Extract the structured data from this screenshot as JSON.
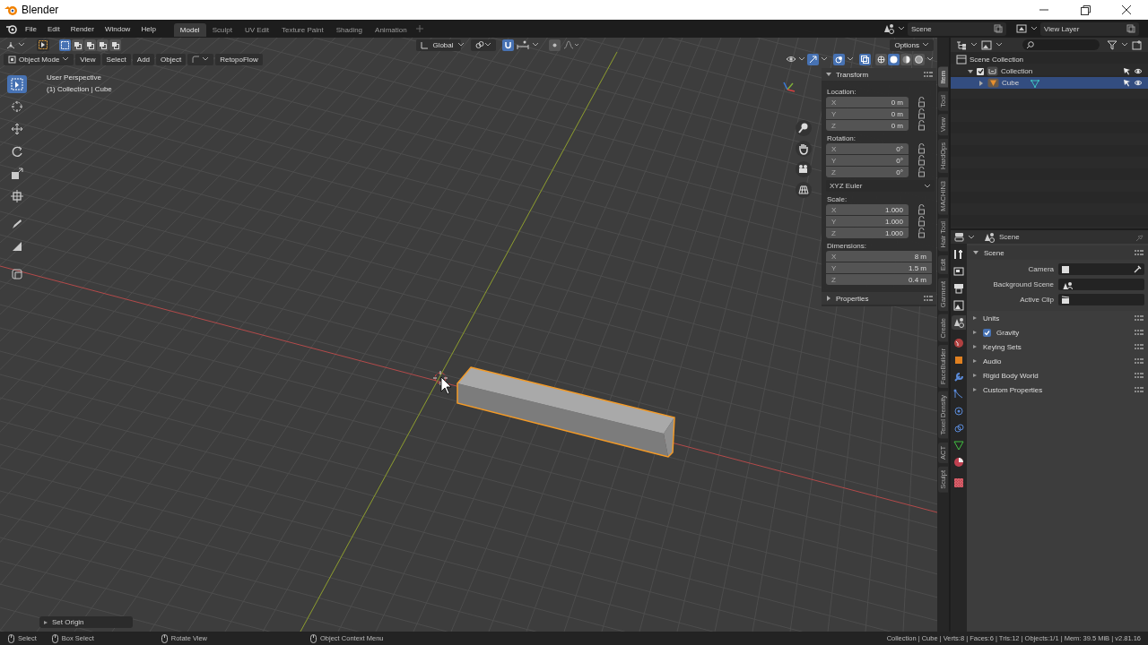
{
  "window": {
    "title": "Blender"
  },
  "menu": [
    "File",
    "Edit",
    "Render",
    "Window",
    "Help"
  ],
  "workspaces": [
    {
      "label": "Model",
      "selected": true
    },
    {
      "label": "Sculpt",
      "selected": false
    },
    {
      "label": "UV Edit",
      "selected": false
    },
    {
      "label": "Texture Paint",
      "selected": false
    },
    {
      "label": "Shading",
      "selected": false
    },
    {
      "label": "Animation",
      "selected": false
    }
  ],
  "scene": {
    "value": "Scene"
  },
  "view_layer": {
    "value": "View Layer"
  },
  "viewport": {
    "select_modes": [
      {
        "selected": true
      },
      {
        "selected": false
      },
      {
        "selected": false
      },
      {
        "selected": false
      },
      {
        "selected": false
      }
    ],
    "orientation": "Global",
    "snap": {
      "on": true
    },
    "options": "Options",
    "mode": "Object Mode",
    "menus": [
      "View",
      "Select",
      "Add",
      "Object"
    ],
    "addon_menu": "RetopoFlow",
    "gizmos": {
      "on": true
    },
    "overlays": {
      "on": true
    },
    "xray": {
      "on": true
    },
    "shading_modes": [
      {
        "selected": false
      },
      {
        "selected": true
      },
      {
        "selected": false
      },
      {
        "selected": false
      }
    ],
    "view_name": "User Perspective",
    "object_info": "(1) Collection | Cube",
    "tools": [
      {
        "selected": true
      },
      {
        "selected": false
      },
      {
        "selected": false
      },
      {
        "selected": false
      },
      {
        "selected": false
      },
      {
        "selected": false
      },
      {
        "selected": false
      },
      {
        "selected": false
      },
      {
        "selected": false
      }
    ],
    "last_operator": "Set Origin"
  },
  "sidebar": {
    "tabs": [
      {
        "label": "Item",
        "selected": true
      },
      {
        "label": "Tool",
        "selected": false
      },
      {
        "label": "View",
        "selected": false
      },
      {
        "label": "HardOps",
        "selected": false
      },
      {
        "label": "MACHIN3",
        "selected": false
      },
      {
        "label": "Hair Tool",
        "selected": false
      },
      {
        "label": "Edit",
        "selected": false
      },
      {
        "label": "Garment",
        "selected": false
      },
      {
        "label": "Create",
        "selected": false
      },
      {
        "label": "FaceBuilder",
        "selected": false
      },
      {
        "label": "Texel Density",
        "selected": false
      },
      {
        "label": "ACT",
        "selected": false
      },
      {
        "label": "Sculpt",
        "selected": false
      }
    ],
    "transform": {
      "title": "Transform",
      "expanded": true
    },
    "location": {
      "label": "Location:",
      "fields": [
        {
          "axis": "X",
          "value": "0 m"
        },
        {
          "axis": "Y",
          "value": "0 m"
        },
        {
          "axis": "Z",
          "value": "0 m"
        }
      ]
    },
    "rotation": {
      "label": "Rotation:",
      "fields": [
        {
          "axis": "X",
          "value": "0°"
        },
        {
          "axis": "Y",
          "value": "0°"
        },
        {
          "axis": "Z",
          "value": "0°"
        }
      ]
    },
    "rotation_mode": "XYZ Euler",
    "scale": {
      "label": "Scale:",
      "fields": [
        {
          "axis": "X",
          "value": "1.000"
        },
        {
          "axis": "Y",
          "value": "1.000"
        },
        {
          "axis": "Z",
          "value": "1.000"
        }
      ]
    },
    "dimensions": {
      "label": "Dimensions:",
      "fields": [
        {
          "axis": "X",
          "value": "8 m"
        },
        {
          "axis": "Y",
          "value": "1.5 m"
        },
        {
          "axis": "Z",
          "value": "0.4 m"
        }
      ]
    },
    "properties": {
      "title": "Properties",
      "expanded": false
    }
  },
  "outliner": {
    "items": [
      {
        "label": "Scene Collection",
        "selected": false,
        "children": [
          {
            "label": "Collection",
            "selected": false,
            "checked": true,
            "expanded": true,
            "children": [
              {
                "label": "Cube",
                "selected": true,
                "expanded": false
              }
            ]
          }
        ]
      }
    ]
  },
  "properties": {
    "tabs": [
      {
        "selected": false
      },
      {
        "selected": false
      },
      {
        "selected": false
      },
      {
        "selected": false
      },
      {
        "selected": true
      },
      {
        "selected": false
      },
      {
        "selected": false
      },
      {
        "selected": false
      },
      {
        "selected": false
      },
      {
        "selected": false
      },
      {
        "selected": false
      },
      {
        "selected": false
      },
      {
        "selected": false
      },
      {
        "selected": false
      }
    ],
    "context": "Scene",
    "panel": {
      "title": "Scene",
      "expanded": true,
      "fields": [
        {
          "label": "Camera"
        },
        {
          "label": "Background Scene"
        },
        {
          "label": "Active Clip"
        }
      ]
    },
    "subpanels": [
      {
        "label": "Units",
        "kind": "panel"
      },
      {
        "label": "Gravity",
        "kind": "checkbox",
        "checked": true
      },
      {
        "label": "Keying Sets",
        "kind": "panel"
      },
      {
        "label": "Audio",
        "kind": "panel"
      },
      {
        "label": "Rigid Body World",
        "kind": "panel"
      },
      {
        "label": "Custom Properties",
        "kind": "panel"
      }
    ]
  },
  "status_bar": {
    "hints": [
      {
        "label": "Select"
      },
      {
        "label": "Box Select"
      },
      {
        "label": "Rotate View"
      },
      {
        "label": "Object Context Menu"
      }
    ],
    "stats": "Collection | Cube | Verts:8 | Faces:6 | Tris:12 | Objects:1/1 | Mem: 39.5 MiB | v2.81.16"
  }
}
